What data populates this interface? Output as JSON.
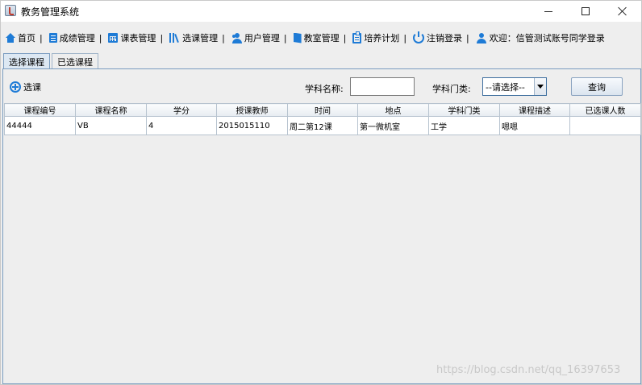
{
  "window": {
    "title": "教务管理系统"
  },
  "menubar": {
    "items": [
      {
        "label": "首页",
        "icon": "home-icon"
      },
      {
        "label": "成绩管理",
        "icon": "document-icon"
      },
      {
        "label": "课表管理",
        "icon": "calendar-icon"
      },
      {
        "label": "选课管理",
        "icon": "books-icon"
      },
      {
        "label": "用户管理",
        "icon": "users-icon"
      },
      {
        "label": "教室管理",
        "icon": "door-icon"
      },
      {
        "label": "培养计划",
        "icon": "clipboard-icon"
      },
      {
        "label": "注销登录",
        "icon": "power-icon"
      }
    ],
    "separator": "|",
    "welcome": "欢迎：信管测试账号同学登录"
  },
  "tabs": [
    "选择课程",
    "已选课程"
  ],
  "toolbar": {
    "add_label": "选课",
    "name_label": "学科名称:",
    "name_value": "",
    "category_label": "学科门类:",
    "category_value": "--请选择--",
    "query_label": "查询"
  },
  "table": {
    "columns": [
      "课程编号",
      "课程名称",
      "学分",
      "授课教师",
      "时间",
      "地点",
      "学科门类",
      "课程描述",
      "已选课人数"
    ],
    "rows": [
      [
        "44444",
        "VB",
        "4",
        "2015015110",
        "周二第12课",
        "第一微机室",
        "工学",
        "嗯嗯",
        ""
      ]
    ]
  },
  "watermark": "https://blog.csdn.net/qq_16397653",
  "colors": {
    "accent": "#1e7bd6",
    "tab_active": "#dde8f3",
    "border": "#7a9cc0"
  }
}
